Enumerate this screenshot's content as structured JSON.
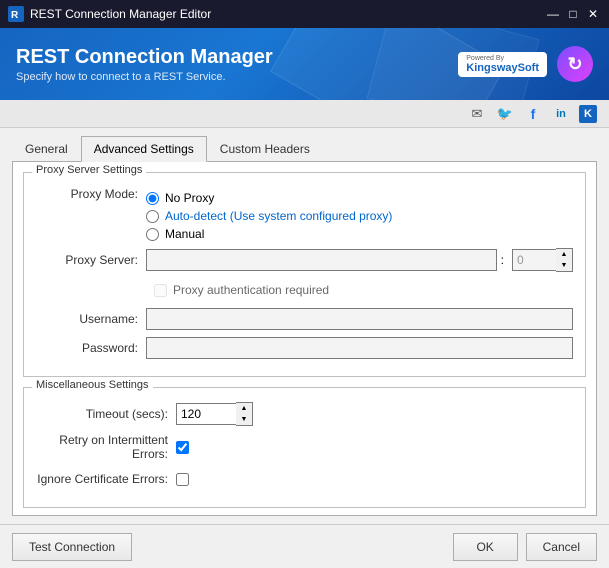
{
  "titleBar": {
    "title": "REST Connection Manager Editor",
    "controls": {
      "minimize": "—",
      "maximize": "□",
      "close": "✕"
    }
  },
  "header": {
    "title": "REST Connection Manager",
    "subtitle": "Specify how to connect to a REST Service.",
    "poweredBy": "Powered By",
    "brandName": "KingswaySoft"
  },
  "socialBar": {
    "icons": [
      "✉",
      "🐦",
      "f",
      "in",
      "K"
    ]
  },
  "tabs": {
    "items": [
      {
        "label": "General",
        "active": false
      },
      {
        "label": "Advanced Settings",
        "active": true
      },
      {
        "label": "Custom Headers",
        "active": false
      }
    ]
  },
  "proxySection": {
    "title": "Proxy Server Settings",
    "proxyModeLabel": "Proxy Mode:",
    "options": [
      {
        "label": "No Proxy",
        "checked": true
      },
      {
        "label": "Auto-detect (Use system configured proxy)",
        "checked": false
      },
      {
        "label": "Manual",
        "checked": false
      }
    ],
    "proxyServerLabel": "Proxy Server:",
    "proxyServerValue": "",
    "proxyServerPlaceholder": "",
    "portValue": "0",
    "proxyAuthLabel": "Proxy authentication required",
    "usernameLabel": "Username:",
    "usernameValue": "",
    "passwordLabel": "Password:",
    "passwordValue": ""
  },
  "miscSection": {
    "title": "Miscellaneous Settings",
    "timeoutLabel": "Timeout (secs):",
    "timeoutValue": "120",
    "retryLabel": "Retry on Intermittent Errors:",
    "retryChecked": true,
    "ignoreCertLabel": "Ignore Certificate Errors:",
    "ignoreCertChecked": false
  },
  "footer": {
    "testConnectionLabel": "Test Connection",
    "okLabel": "OK",
    "cancelLabel": "Cancel"
  }
}
